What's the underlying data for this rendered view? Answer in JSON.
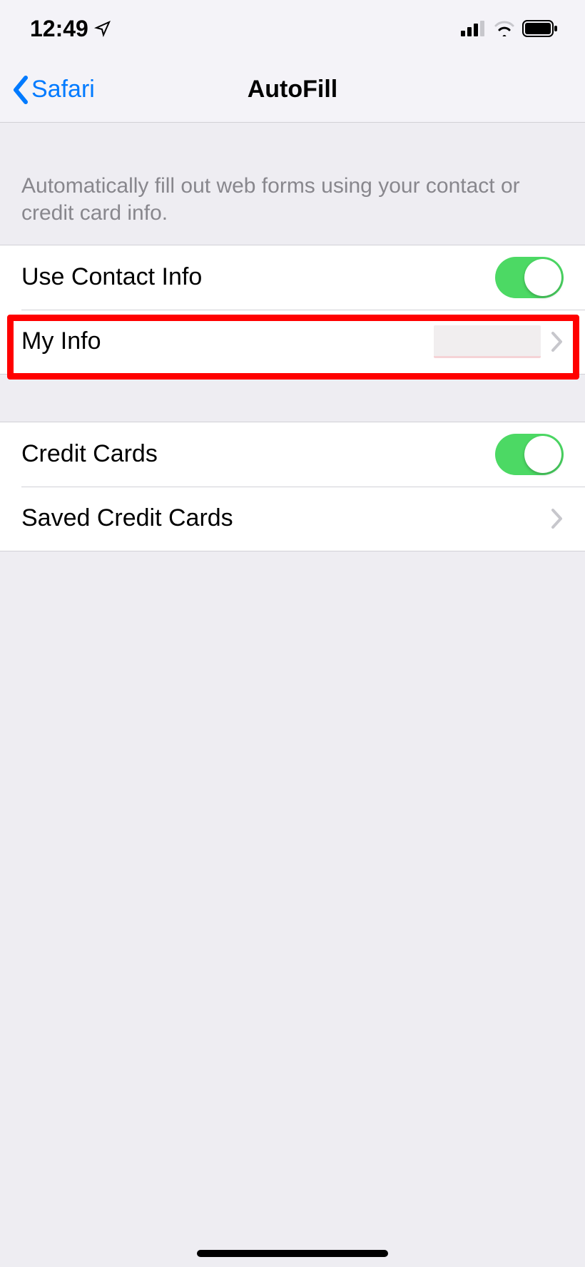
{
  "status_bar": {
    "time": "12:49"
  },
  "nav": {
    "back_label": "Safari",
    "title": "AutoFill"
  },
  "header_text": "Automatically fill out web forms using your contact or credit card info.",
  "sections": [
    {
      "items": [
        {
          "label": "Use Contact Info",
          "type": "toggle",
          "value": true
        },
        {
          "label": "My Info",
          "type": "nav",
          "value": ""
        }
      ]
    },
    {
      "items": [
        {
          "label": "Credit Cards",
          "type": "toggle",
          "value": true
        },
        {
          "label": "Saved Credit Cards",
          "type": "nav"
        }
      ]
    }
  ]
}
